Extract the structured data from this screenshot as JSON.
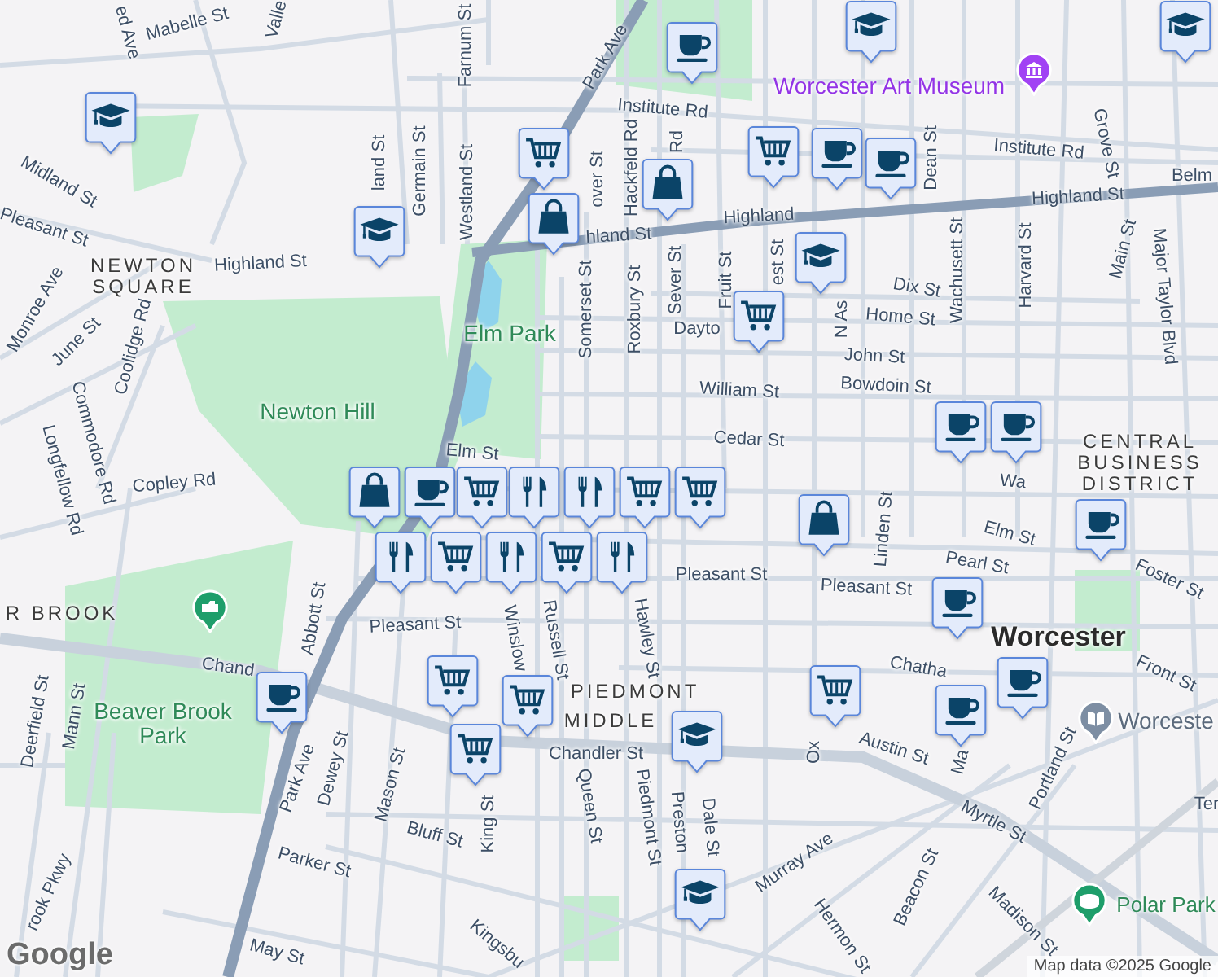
{
  "map": {
    "labels": [
      {
        "text": "ed Ave",
        "kind": "street"
      },
      {
        "text": "Mabelle St",
        "kind": "street"
      },
      {
        "text": "Valle",
        "kind": "street"
      },
      {
        "text": "Farnum St",
        "kind": "street"
      },
      {
        "text": "Park Ave",
        "kind": "street"
      },
      {
        "text": "Institute Rd",
        "kind": "street"
      },
      {
        "text": "Worcester Art Museum",
        "kind": "poi"
      },
      {
        "text": "Institute Rd",
        "kind": "street"
      },
      {
        "text": "Midland St",
        "kind": "street"
      },
      {
        "text": "Pleasant St",
        "kind": "street"
      },
      {
        "text": "land St",
        "kind": "street"
      },
      {
        "text": "Germain St",
        "kind": "street"
      },
      {
        "text": "Westland St",
        "kind": "street"
      },
      {
        "text": "over St",
        "kind": "street"
      },
      {
        "text": "Hackfeld Rd",
        "kind": "street"
      },
      {
        "text": "Rd",
        "kind": "street"
      },
      {
        "text": "Dean St",
        "kind": "street"
      },
      {
        "text": "Grove St",
        "kind": "street"
      },
      {
        "text": "Highland St",
        "kind": "street"
      },
      {
        "text": "hland St",
        "kind": "street"
      },
      {
        "text": "Highland",
        "kind": "street"
      },
      {
        "text": "Highland St",
        "kind": "street"
      },
      {
        "text": "Belm",
        "kind": "street"
      },
      {
        "text": "NEWTON SQUARE",
        "kind": "district"
      },
      {
        "text": "Somerset St",
        "kind": "street"
      },
      {
        "text": "Roxbury St",
        "kind": "street"
      },
      {
        "text": "Sever St",
        "kind": "street"
      },
      {
        "text": "Fruit St",
        "kind": "street"
      },
      {
        "text": "est St",
        "kind": "street"
      },
      {
        "text": "N As",
        "kind": "street"
      },
      {
        "text": "Wachusett St",
        "kind": "street"
      },
      {
        "text": "Harvard St",
        "kind": "street"
      },
      {
        "text": "Main St",
        "kind": "street"
      },
      {
        "text": "Major Taylor Blvd",
        "kind": "street"
      },
      {
        "text": "Monroe Ave",
        "kind": "street"
      },
      {
        "text": "June St",
        "kind": "street"
      },
      {
        "text": "Coolidge Rd",
        "kind": "street"
      },
      {
        "text": "Elm Park",
        "kind": "park"
      },
      {
        "text": "Dix St",
        "kind": "street"
      },
      {
        "text": "Home St",
        "kind": "street"
      },
      {
        "text": "Dayto",
        "kind": "street"
      },
      {
        "text": "John St",
        "kind": "street"
      },
      {
        "text": "William St",
        "kind": "street"
      },
      {
        "text": "Bowdoin St",
        "kind": "street"
      },
      {
        "text": "Newton Hill",
        "kind": "park"
      },
      {
        "text": "Commodore Rd",
        "kind": "street"
      },
      {
        "text": "Longfellow Rd",
        "kind": "street"
      },
      {
        "text": "Cedar St",
        "kind": "street"
      },
      {
        "text": "Elm St",
        "kind": "street"
      },
      {
        "text": "Wa",
        "kind": "street"
      },
      {
        "text": "CENTRAL BUSINESS DISTRICT",
        "kind": "district"
      },
      {
        "text": "Copley Rd",
        "kind": "street"
      },
      {
        "text": "Linden St",
        "kind": "street"
      },
      {
        "text": "Elm St",
        "kind": "street"
      },
      {
        "text": "Pearl St",
        "kind": "street"
      },
      {
        "text": "Foster St",
        "kind": "street"
      },
      {
        "text": "Pleasant St",
        "kind": "street"
      },
      {
        "text": "Pleasant St",
        "kind": "street"
      },
      {
        "text": "Pleasant St",
        "kind": "street"
      },
      {
        "text": "R BROOK",
        "kind": "district"
      },
      {
        "text": "Abbott St",
        "kind": "street"
      },
      {
        "text": "Winslow",
        "kind": "street"
      },
      {
        "text": "Russell St",
        "kind": "street"
      },
      {
        "text": "Hawley St",
        "kind": "street"
      },
      {
        "text": "Worcester",
        "kind": "city"
      },
      {
        "text": "Chatha",
        "kind": "street"
      },
      {
        "text": "Front St",
        "kind": "street"
      },
      {
        "text": "Worceste",
        "kind": "place"
      },
      {
        "text": "PIEDMONT",
        "kind": "district"
      },
      {
        "text": "MIDDLE",
        "kind": "district"
      },
      {
        "text": "Chand",
        "kind": "street"
      },
      {
        "text": "Chandler St",
        "kind": "street"
      },
      {
        "text": "Deerfield St",
        "kind": "street"
      },
      {
        "text": "Mann St",
        "kind": "street"
      },
      {
        "text": "Beaver Brook Park",
        "kind": "park"
      },
      {
        "text": "Park Ave",
        "kind": "street"
      },
      {
        "text": "Dewey St",
        "kind": "street"
      },
      {
        "text": "Mason St",
        "kind": "street"
      },
      {
        "text": "King St",
        "kind": "street"
      },
      {
        "text": "Queen St",
        "kind": "street"
      },
      {
        "text": "Piedmont St",
        "kind": "street"
      },
      {
        "text": "Preston",
        "kind": "street"
      },
      {
        "text": "Dale St",
        "kind": "street"
      },
      {
        "text": "Ox",
        "kind": "street"
      },
      {
        "text": "Austin St",
        "kind": "street"
      },
      {
        "text": "Ma",
        "kind": "street"
      },
      {
        "text": "Portland St",
        "kind": "street"
      },
      {
        "text": "Myrtle St",
        "kind": "street"
      },
      {
        "text": "Ter",
        "kind": "street"
      },
      {
        "text": "Bluff St",
        "kind": "street"
      },
      {
        "text": "Parker St",
        "kind": "street"
      },
      {
        "text": "Murray Ave",
        "kind": "street"
      },
      {
        "text": "Beacon St",
        "kind": "street"
      },
      {
        "text": "Polar Park",
        "kind": "park"
      },
      {
        "text": "Hermon St",
        "kind": "street"
      },
      {
        "text": "Madison St",
        "kind": "street"
      },
      {
        "text": "Kingsbu",
        "kind": "street"
      },
      {
        "text": "May St",
        "kind": "street"
      },
      {
        "text": "rook Pkwy",
        "kind": "street"
      }
    ],
    "pins": [
      {
        "kind": "museum"
      },
      {
        "kind": "park"
      },
      {
        "kind": "library"
      },
      {
        "kind": "stadium"
      }
    ],
    "markers": [
      {
        "kind": "coffee"
      },
      {
        "kind": "school"
      },
      {
        "kind": "school"
      },
      {
        "kind": "school"
      },
      {
        "kind": "cart"
      },
      {
        "kind": "cart"
      },
      {
        "kind": "coffee"
      },
      {
        "kind": "coffee"
      },
      {
        "kind": "bag"
      },
      {
        "kind": "bag"
      },
      {
        "kind": "school"
      },
      {
        "kind": "school"
      },
      {
        "kind": "cart"
      },
      {
        "kind": "coffee"
      },
      {
        "kind": "coffee"
      },
      {
        "kind": "cart"
      },
      {
        "kind": "bag"
      },
      {
        "kind": "coffee"
      },
      {
        "kind": "restaurant"
      },
      {
        "kind": "cart"
      },
      {
        "kind": "restaurant"
      },
      {
        "kind": "restaurant"
      },
      {
        "kind": "cart"
      },
      {
        "kind": "restaurant"
      },
      {
        "kind": "cart"
      },
      {
        "kind": "restaurant"
      },
      {
        "kind": "cart"
      },
      {
        "kind": "bag"
      },
      {
        "kind": "coffee"
      },
      {
        "kind": "coffee"
      },
      {
        "kind": "coffee"
      },
      {
        "kind": "coffee"
      },
      {
        "kind": "cart"
      },
      {
        "kind": "cart"
      },
      {
        "kind": "cart"
      },
      {
        "kind": "coffee"
      },
      {
        "kind": "school"
      },
      {
        "kind": "cart"
      },
      {
        "kind": "school"
      }
    ]
  },
  "logo": "Google",
  "attribution": "Map data ©2025 Google"
}
